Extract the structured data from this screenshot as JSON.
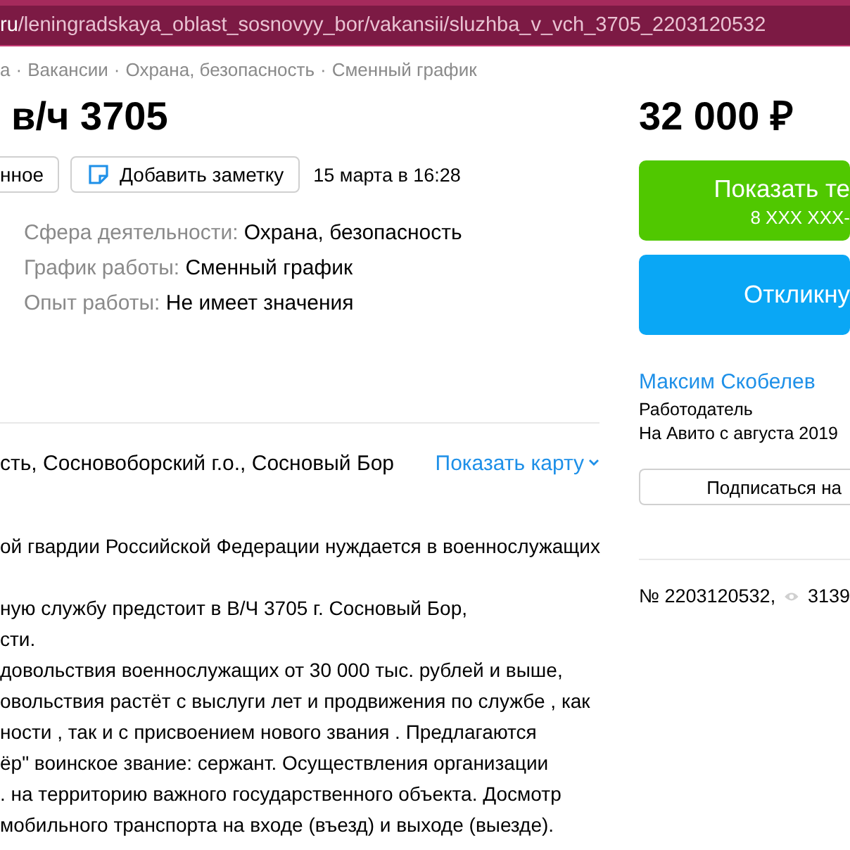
{
  "address_bar": {
    "url": "ru/leningradskaya_oblast_sosnovyy_bor/vakansii/sluzhba_v_vch_3705_2203120532"
  },
  "breadcrumbs": [
    "а",
    "Вакансии",
    "Охрана, безопасность",
    "Сменный график"
  ],
  "breadcrumb_separator": "·",
  "title": "в/ч 3705",
  "price": "32 000 ₽",
  "actions": [
    {
      "kind": "plain",
      "label": "нное"
    },
    {
      "kind": "note",
      "label": "Добавить заметку"
    }
  ],
  "date": "15 марта в 16:28",
  "params": [
    {
      "label": "Сфера деятельности:",
      "value": "Охрана, безопасность"
    },
    {
      "label": "График работы:",
      "value": "Сменный график"
    },
    {
      "label": "Опыт работы:",
      "value": "Не имеет значения"
    }
  ],
  "address": {
    "text": "сть, Сосновоборский г.о., Сосновый Бор",
    "map_link": "Показать карту"
  },
  "description": [
    [
      "ой гвардии Российской Федерации нуждается в военнослужащих"
    ],
    [
      "ную службу предстоит в В/Ч 3705 г. Сосновый Бор,",
      "сти.",
      "довольствия военнослужащих от 30 000 тыс. рублей и выше,",
      "овольствия растёт с выслуги лет и продвижения по службе , как",
      "ности , так и с присвоением нового звания . Предлагаются",
      "ёр\" воинское звание: сержант. Осуществления организации",
      ". на территорию важного государственного объекта. Досмотр",
      "мобильного транспорта на входе (въезд) и выходе (выезде)."
    ]
  ],
  "contact_buttons": [
    {
      "kind": "phone",
      "label": "Показать те",
      "sublabel": "8 XXX XXX-"
    },
    {
      "kind": "respond",
      "label": "Откликну"
    }
  ],
  "seller": {
    "name": "Максим Скобелев",
    "role": "Работодатель",
    "since": "На Авито с августа 2019",
    "subscribe": "Подписаться на"
  },
  "stats": {
    "number": "№ 2203120532,",
    "views": "3139"
  }
}
